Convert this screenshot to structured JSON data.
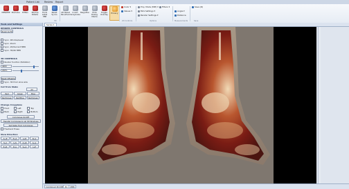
{
  "titlebar": {
    "tabs": [
      "Patient List",
      "Review",
      "Report"
    ]
  },
  "ribbon": {
    "buttons": [
      {
        "label": "MPR/MIP"
      },
      {
        "label": "3D/Cube"
      },
      {
        "label": "PVRen"
      },
      {
        "label": "3D/Clip Rotate"
      },
      {
        "label": "Tools Label 3BP"
      },
      {
        "label": "Reset Syncs"
      },
      {
        "label": "2D Reset Pan/Zoom"
      },
      {
        "label": "Invert Grayscale"
      },
      {
        "label": "Magnifier"
      },
      {
        "label": "Hide Dialog Marks"
      },
      {
        "label": "Toggle Overlay"
      },
      {
        "label": "Privacy"
      }
    ],
    "small_items": [
      "Color ▾",
      "Values ▾",
      "Proj. Mode (MIP) ▾",
      "MLS Settings ▾",
      "Render Settings ▾",
      "Filters ▾",
      "Angle ▾",
      "Distance",
      "Save (R)"
    ],
    "groups": [
      "3D",
      "2D Controls",
      "Options",
      "Measurements",
      "Save"
    ]
  },
  "leftpanel": {
    "header": "Tools and Settings",
    "render_controls_title": "RENDER CONTROLS",
    "zoom_button": "Zoom to Fit",
    "checks1": [
      "Sync. Window/Level",
      "Sync. Zoom",
      "Sync. 2D/Current MPR",
      "Sync. 3D/All MPR"
    ],
    "controls_3d_title": "3D CONTROLS",
    "render_function_label": "Render function (Rotation):",
    "value1": "4000",
    "value2": "200%",
    "reset_button": "Reset Offset/Gain",
    "check_sync_3d": "Sync. 3D from slice side",
    "cut_from_title": "Cut from Slabs",
    "cut_all": "All",
    "cut_buttons": [
      "Red",
      "Green",
      "Blue"
    ],
    "slab_buttons": [
      "Red/Green",
      "Red/Blue",
      "Red/Green"
    ],
    "change_crop_title": "Change Cropplane",
    "crop_checks": [
      "Front",
      "Left",
      "Top",
      "Back",
      "Right",
      "Bottom"
    ],
    "cut_on_off_button": "Cut planes On/Off",
    "transfer_button": "Transfer Cut planes to all 3D Windows",
    "select_button": "Set Slabs from Cut planes",
    "freehand_check": "Freehand Erase",
    "view_direction_title": "View Direction",
    "view_buttons": [
      "A→P",
      "P→A",
      "L→R",
      "R→L",
      "S→I",
      "I→S",
      "A→R",
      "A→L",
      "P→R",
      "P→L",
      "S→A",
      "I→P"
    ]
  },
  "main": {
    "view_tab": "Series 1",
    "bottom_tabs": [
      "Combined 3D MPR",
      "3D",
      "MPR"
    ]
  },
  "colors": {
    "accent": "#3c6fb3",
    "render_bg": "#7f776f",
    "viewport_bg": "#000000"
  }
}
